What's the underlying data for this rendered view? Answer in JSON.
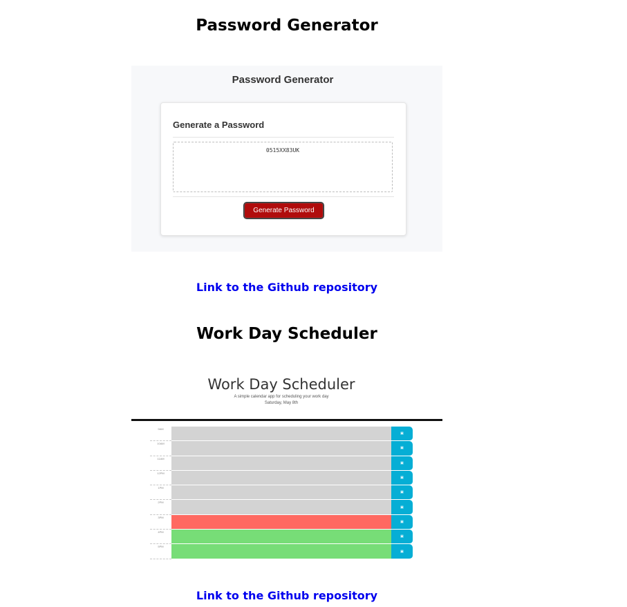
{
  "sections": [
    {
      "title": "Password Generator",
      "link_text": "Link to the Github repository"
    },
    {
      "title": "Work Day Scheduler",
      "link_text": "Link to the Github repository"
    }
  ],
  "password_app": {
    "header": "Password Generator",
    "card_title": "Generate a Password",
    "password_value": "0515XX83UK",
    "button_label": "Generate Password",
    "button_color": "#b00c0c"
  },
  "scheduler_app": {
    "title": "Work Day Scheduler",
    "subtitle": "A simple calendar app for scheduling your work day",
    "date": "Saturday, May 8th",
    "save_icon": "save-icon",
    "colors": {
      "past": "#d3d3d3",
      "present": "#ff6961",
      "future": "#77dd77",
      "save": "#06aed5"
    },
    "rows": [
      {
        "hour": "9AM",
        "state": "past"
      },
      {
        "hour": "10AM",
        "state": "past"
      },
      {
        "hour": "11AM",
        "state": "past"
      },
      {
        "hour": "12PM",
        "state": "past"
      },
      {
        "hour": "1PM",
        "state": "past"
      },
      {
        "hour": "2PM",
        "state": "past"
      },
      {
        "hour": "3PM",
        "state": "present"
      },
      {
        "hour": "4PM",
        "state": "future"
      },
      {
        "hour": "5PM",
        "state": "future"
      }
    ]
  }
}
